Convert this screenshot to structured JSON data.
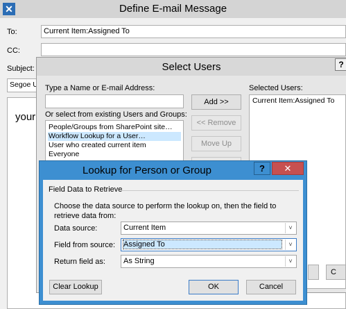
{
  "email": {
    "title": "Define E-mail Message",
    "to_label": "To:",
    "to_value": "Current Item:Assigned To",
    "cc_label": "CC:",
    "subject_label": "Subject:",
    "font_value": "Segoe U",
    "body_text": "your"
  },
  "select_users": {
    "title": "Select Users",
    "help": "?",
    "type_name_label": "Type a Name or E-mail Address:",
    "or_select_label": "Or select from existing Users and Groups:",
    "items": [
      "People/Groups from SharePoint site…",
      "Workflow Lookup for a User…",
      "User who created current item",
      "Everyone"
    ],
    "selected_label": "Selected Users:",
    "selected_items": [
      "Current Item:Assigned To"
    ],
    "add_button": "Add >>",
    "remove_button": "<< Remove",
    "moveup_button": "Move Up",
    "cancel_partial": "C"
  },
  "lookup": {
    "title": "Lookup for Person or Group",
    "help": "?",
    "close": "✕",
    "group_label": "Field Data to Retrieve",
    "instructions": "Choose the data source to perform the lookup on, then the field to retrieve data from:",
    "data_source_label": "Data source:",
    "data_source_value": "Current Item",
    "field_label": "Field from source:",
    "field_value": "Assigned To",
    "return_label": "Return field as:",
    "return_value": "As String",
    "clear_button": "Clear Lookup",
    "ok_button": "OK",
    "cancel_button": "Cancel"
  }
}
